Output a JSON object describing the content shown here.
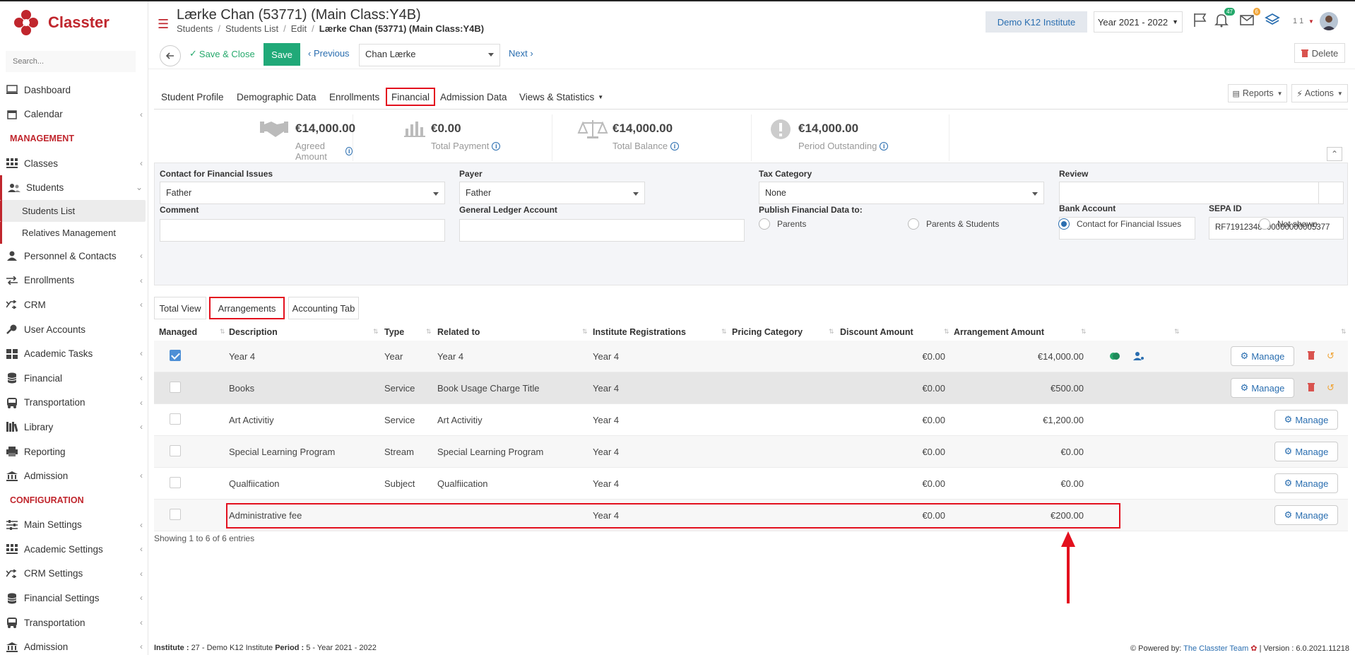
{
  "app": {
    "name": "Classter",
    "search_placeholder": "Search..."
  },
  "sidebar": {
    "items": [
      {
        "label": "Dashboard",
        "icon": "monitor-icon"
      },
      {
        "label": "Calendar",
        "icon": "calendar-icon",
        "has_children": true
      },
      {
        "section": "MANAGEMENT"
      },
      {
        "label": "Classes",
        "icon": "grid-icon",
        "has_children": true
      },
      {
        "label": "Students",
        "icon": "users-icon",
        "has_children": true,
        "expanded": true
      },
      {
        "label": "Personnel & Contacts",
        "icon": "person-icon",
        "has_children": true
      },
      {
        "label": "Enrollments",
        "icon": "exchange-icon",
        "has_children": true
      },
      {
        "label": "CRM",
        "icon": "shuffle-icon",
        "has_children": true
      },
      {
        "label": "User Accounts",
        "icon": "key-icon"
      },
      {
        "label": "Academic Tasks",
        "icon": "tasks-icon",
        "has_children": true
      },
      {
        "label": "Financial",
        "icon": "coins-icon",
        "has_children": true
      },
      {
        "label": "Transportation",
        "icon": "bus-icon",
        "has_children": true
      },
      {
        "label": "Library",
        "icon": "books-icon",
        "has_children": true
      },
      {
        "label": "Reporting",
        "icon": "printer-icon"
      },
      {
        "label": "Admission",
        "icon": "bank-icon",
        "has_children": true
      },
      {
        "section": "CONFIGURATION"
      },
      {
        "label": "Main Settings",
        "icon": "sliders-icon",
        "has_children": true
      },
      {
        "label": "Academic Settings",
        "icon": "grid-icon",
        "has_children": true
      },
      {
        "label": "CRM Settings",
        "icon": "shuffle-icon",
        "has_children": true
      },
      {
        "label": "Financial Settings",
        "icon": "coins-icon",
        "has_children": true
      },
      {
        "label": "Transportation",
        "icon": "bus-icon",
        "has_children": true
      },
      {
        "label": "Admission",
        "icon": "bank-icon",
        "has_children": true
      }
    ],
    "students_sub": [
      {
        "label": "Students List",
        "selected": true
      },
      {
        "label": "Relatives Management"
      }
    ]
  },
  "header": {
    "title": "Lærke Chan (53771) (Main Class:Y4B)",
    "breadcrumb": [
      "Students",
      "Students List",
      "Edit",
      "Lærke Chan (53771) (Main Class:Y4B)"
    ],
    "institute": "Demo K12 Institute",
    "year": "Year 2021 - 2022",
    "notifications": "47",
    "messages": "6",
    "user_count": "1 1"
  },
  "toolbar": {
    "save_close": "Save & Close",
    "save": "Save",
    "previous": "Previous",
    "student": "Chan Lærke",
    "next": "Next",
    "delete": "Delete"
  },
  "tabs": [
    {
      "label": "Student Profile"
    },
    {
      "label": "Demographic Data"
    },
    {
      "label": "Enrollments"
    },
    {
      "label": "Financial",
      "active": true
    },
    {
      "label": "Admission Data"
    },
    {
      "label": "Views & Statistics"
    }
  ],
  "tab_actions": {
    "reports": "Reports",
    "actions": "Actions"
  },
  "summary": [
    {
      "amount": "€14,000.00",
      "label": "Agreed Amount",
      "icon": "handshake-icon"
    },
    {
      "amount": "€0.00",
      "label": "Total Payment",
      "icon": "bar-chart-icon"
    },
    {
      "amount": "€14,000.00",
      "label": "Total Balance",
      "icon": "scale-icon"
    },
    {
      "amount": "€14,000.00",
      "label": "Period Outstanding",
      "icon": "exclamation-icon"
    }
  ],
  "form": {
    "contact_label": "Contact for Financial Issues",
    "contact_value": "Father",
    "payer_label": "Payer",
    "payer_value": "Father",
    "tax_label": "Tax Category",
    "tax_value": "None",
    "review_label": "Review",
    "bank_label": "Bank Account",
    "sepa_label": "SEPA ID",
    "sepa_value": "RF71912348000000000005377",
    "comment_label": "Comment",
    "ledger_label": "General Ledger Account",
    "publish_label": "Publish Financial Data to:",
    "publish_options": [
      "Parents",
      "Parents & Students",
      "Contact for Financial Issues",
      "Not shown"
    ],
    "publish_selected": "Contact for Financial Issues"
  },
  "subtabs": [
    {
      "label": "Total View"
    },
    {
      "label": "Arrangements",
      "active": true
    },
    {
      "label": "Accounting Tab"
    }
  ],
  "table": {
    "headers": [
      "Managed",
      "Description",
      "Type",
      "Related to",
      "Institute Registrations",
      "Pricing Category",
      "Discount Amount",
      "Arrangement Amount"
    ],
    "manage_label": "Manage",
    "rows": [
      {
        "managed": true,
        "description": "Year 4",
        "type": "Year",
        "related": "Year 4",
        "registration": "Year 4",
        "pricing": "",
        "discount": "€0.00",
        "amount": "€14,000.00"
      },
      {
        "managed": false,
        "description": "Books",
        "type": "Service",
        "related": "Book Usage Charge Title",
        "registration": "Year 4",
        "pricing": "",
        "discount": "€0.00",
        "amount": "€500.00"
      },
      {
        "managed": false,
        "description": "Art Activitiy",
        "type": "Service",
        "related": "Art Activitiy",
        "registration": "Year 4",
        "pricing": "",
        "discount": "€0.00",
        "amount": "€1,200.00"
      },
      {
        "managed": false,
        "description": "Special Learning Program",
        "type": "Stream",
        "related": "Special Learning Program",
        "registration": "Year 4",
        "pricing": "",
        "discount": "€0.00",
        "amount": "€0.00"
      },
      {
        "managed": false,
        "description": "Qualfiication",
        "type": "Subject",
        "related": "Qualfiication",
        "registration": "Year 4",
        "pricing": "",
        "discount": "€0.00",
        "amount": "€0.00"
      },
      {
        "managed": false,
        "description": "Administrative fee",
        "type": "",
        "related": "",
        "registration": "Year 4",
        "pricing": "",
        "discount": "€0.00",
        "amount": "€200.00"
      }
    ],
    "entries": "Showing 1 to 6 of 6 entries"
  },
  "footer": {
    "institute_label": "Institute :",
    "institute_value": "27 - Demo K12 Institute",
    "period_label": "Period :",
    "period_value": "5 - Year 2021 - 2022",
    "powered_label": "Powered by:",
    "powered_link": "The Classter Team",
    "version": "| Version : 6.0.2021.11218"
  },
  "colors": {
    "brand": "#c0262d",
    "link": "#2a6eb0",
    "save": "#20a978",
    "annotation": "#e3101e"
  }
}
